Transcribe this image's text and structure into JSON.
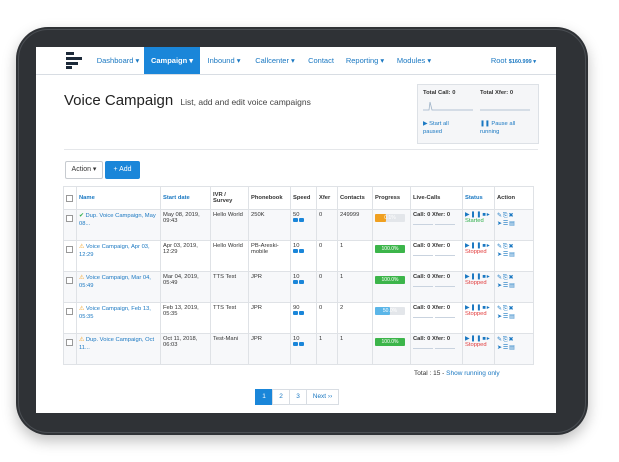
{
  "nav": {
    "items": [
      {
        "label": "Dashboard ▾"
      },
      {
        "label": "Campaign ▾"
      },
      {
        "label": "Inbound ▾"
      },
      {
        "label": "Callcenter ▾"
      },
      {
        "label": "Contact"
      },
      {
        "label": "Reporting ▾"
      },
      {
        "label": "Modules ▾"
      }
    ],
    "user": "Root",
    "balance": "$160.999 ▾"
  },
  "page": {
    "title": "Voice Campaign",
    "subtitle": "List, add and edit voice campaigns"
  },
  "stats": {
    "total_call": "Total Call: 0",
    "total_xfer": "Total Xfer: 0",
    "start_all": "Start all paused",
    "pause_all": "Pause all running"
  },
  "toolbar": {
    "action_label": "Action ▾",
    "add_label": "+ Add"
  },
  "table": {
    "headers": {
      "name": "Name",
      "start_date": "Start date",
      "ivr": "IVR / Survey",
      "phonebook": "Phonebook",
      "speed": "Speed",
      "xfer": "Xfer",
      "contacts": "Contacts",
      "progress": "Progress",
      "live": "Live-Calls",
      "status": "Status",
      "action": "Action"
    },
    "rows": [
      {
        "name": "Dup. Voice Campaign, May 08...",
        "icon": "check-circle",
        "start": "May 08, 2019, 09:43",
        "ivr": "Hello World",
        "phonebook": "250K",
        "speed": "50",
        "xfer": "0",
        "contacts": "249999",
        "progress_label": "0.1%",
        "progress": 0.35,
        "progress_color": "#f0a020",
        "call": "Call: 0",
        "xferl": "Xfer: 0",
        "status": "Started"
      },
      {
        "name": "Voice Campaign, Apr 03, 12:29",
        "icon": "warning",
        "start": "Apr 03, 2019, 12:29",
        "ivr": "Hello World",
        "phonebook": "PB-Areski-mobile",
        "speed": "10",
        "xfer": "0",
        "contacts": "1",
        "progress_label": "100.0%",
        "progress": 1.0,
        "progress_color": "#3cb54a",
        "call": "Call: 0",
        "xferl": "Xfer: 0",
        "status": "Stopped"
      },
      {
        "name": "Voice Campaign, Mar 04, 05:49",
        "icon": "warning",
        "start": "Mar 04, 2019, 05:49",
        "ivr": "TTS Test",
        "phonebook": "JPR",
        "speed": "10",
        "xfer": "0",
        "contacts": "1",
        "progress_label": "100.0%",
        "progress": 1.0,
        "progress_color": "#3cb54a",
        "call": "Call: 0",
        "xferl": "Xfer: 0",
        "status": "Stopped"
      },
      {
        "name": "Voice Campaign, Feb 13, 05:35",
        "icon": "warning",
        "start": "Feb 13, 2019, 05:35",
        "ivr": "TTS Test",
        "phonebook": "JPR",
        "speed": "90",
        "xfer": "0",
        "contacts": "2",
        "progress_label": "50.0%",
        "progress": 0.5,
        "progress_color": "#5bb6e8",
        "call": "Call: 0",
        "xferl": "Xfer: 0",
        "status": "Stopped"
      },
      {
        "name": "Dup. Voice Campaign, Oct 11...",
        "icon": "warning",
        "start": "Oct 11, 2018, 06:03",
        "ivr": "Test-Mani",
        "phonebook": "JPR",
        "speed": "10",
        "xfer": "1",
        "contacts": "1",
        "progress_label": "100.0%",
        "progress": 1.0,
        "progress_color": "#3cb54a",
        "call": "Call: 0",
        "xferl": "Xfer: 0",
        "status": "Stopped"
      }
    ]
  },
  "footer": {
    "total": "Total : 15 - ",
    "show_running": "Show running only"
  },
  "pagination": {
    "pages": [
      "1",
      "2",
      "3"
    ],
    "next": "Next ››"
  },
  "colors": {
    "accent": "#1a86d9",
    "started": "#2eae4a",
    "stopped": "#e23b3b"
  }
}
